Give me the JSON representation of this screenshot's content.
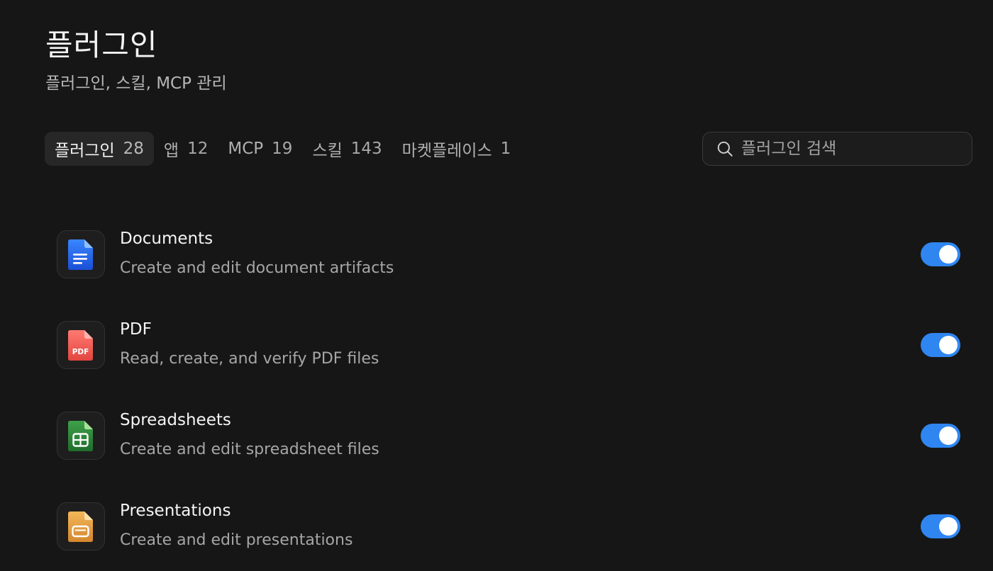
{
  "header": {
    "title": "플러그인",
    "subtitle": "플러그인, 스킬, MCP 관리"
  },
  "tabs": [
    {
      "label": "플러그인",
      "count": "28",
      "active": true
    },
    {
      "label": "앱",
      "count": "12"
    },
    {
      "label": "MCP",
      "count": "19"
    },
    {
      "label": "스킬",
      "count": "143"
    },
    {
      "label": "마켓플레이스",
      "count": "1"
    }
  ],
  "search": {
    "placeholder": "플러그인 검색",
    "icon": "search-icon"
  },
  "plugins": [
    {
      "name": "Documents",
      "description": "Create and edit document artifacts",
      "icon": "documents-icon",
      "enabled": true
    },
    {
      "name": "PDF",
      "description": "Read, create, and verify PDF files",
      "icon": "pdf-icon",
      "icon_text": "PDF",
      "enabled": true
    },
    {
      "name": "Spreadsheets",
      "description": "Create and edit spreadsheet files",
      "icon": "spreadsheets-icon",
      "enabled": true
    },
    {
      "name": "Presentations",
      "description": "Create and edit presentations",
      "icon": "presentations-icon",
      "enabled": true
    }
  ],
  "colors": {
    "background": "#161616",
    "toggle_on": "#2f86f0",
    "docs_blue": "#2a6ef0",
    "pdf_red": "#ee5a55",
    "sheets_green": "#2f8a3a",
    "slides_orange": "#e8a347"
  }
}
